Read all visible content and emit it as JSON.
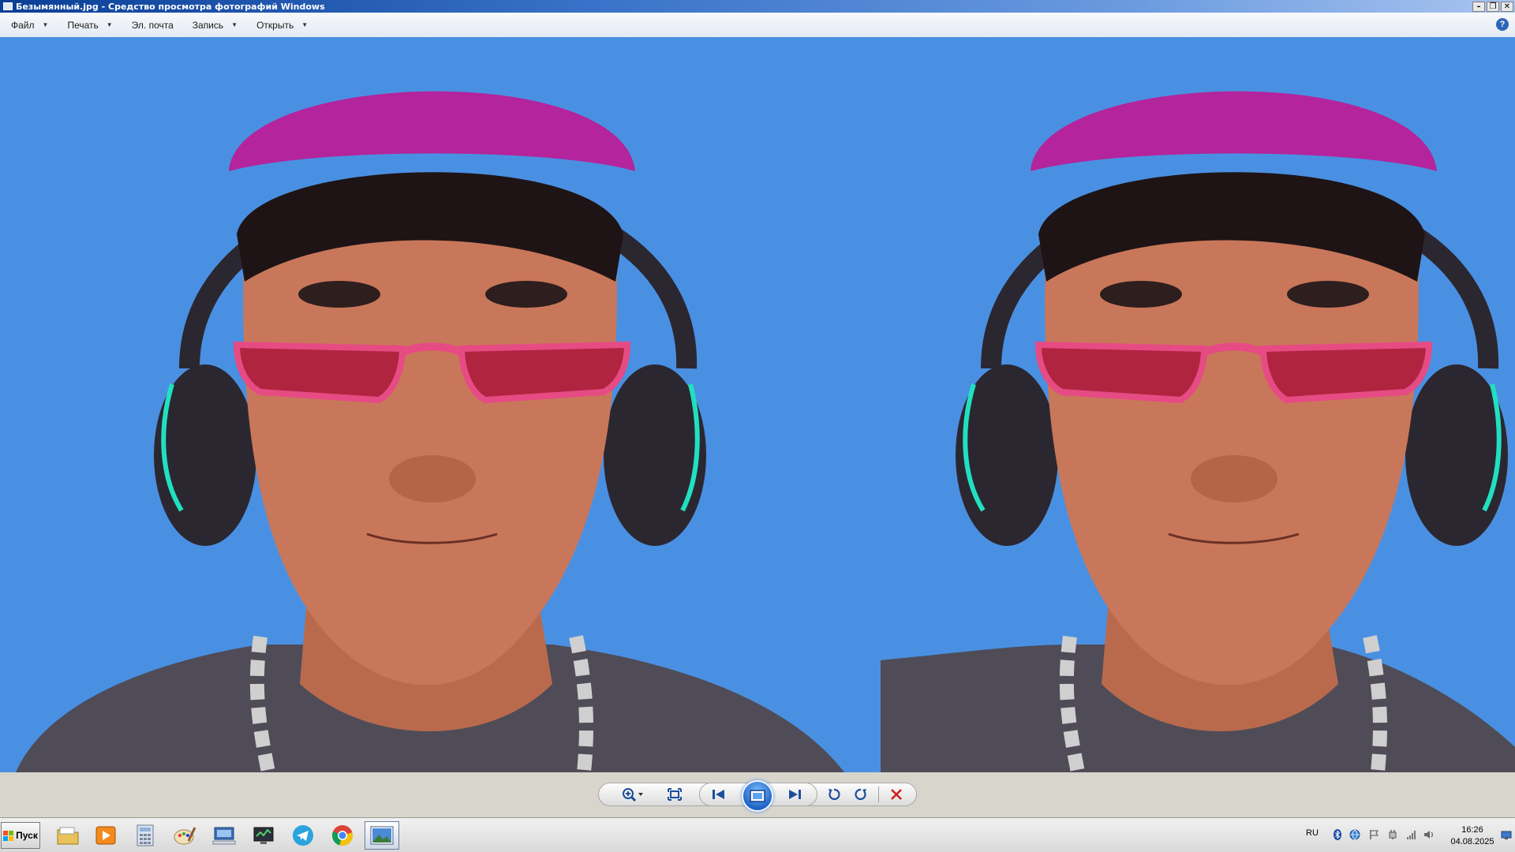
{
  "window": {
    "title": "Безымянный.jpg - Средство просмотра фотографий Windows",
    "minimize_label": "–",
    "restore_label": "❐",
    "close_label": "✕"
  },
  "menu": {
    "items": [
      {
        "label": "Файл",
        "has_dropdown": true
      },
      {
        "label": "Печать",
        "has_dropdown": true
      },
      {
        "label": "Эл. почта",
        "has_dropdown": false
      },
      {
        "label": "Запись",
        "has_dropdown": true
      },
      {
        "label": "Открыть",
        "has_dropdown": true
      }
    ],
    "help_label": "?"
  },
  "viewer": {
    "background_color": "#4a90e2",
    "image_content": "two 3D cartoon avatars side by side: man with magenta cap, pink sunglasses, headphones, silver chain, dark t-shirt"
  },
  "controls": {
    "buttons": [
      "zoom-icon",
      "fit-to-window-icon",
      "previous-icon",
      "slideshow-icon",
      "next-icon",
      "rotate-counterclockwise-icon",
      "rotate-clockwise-icon",
      "delete-icon"
    ]
  },
  "taskbar": {
    "start_label": "Пуск",
    "apps": [
      "file-explorer-icon",
      "media-player-icon",
      "calculator-icon",
      "paint-icon",
      "remote-desktop-icon",
      "network-monitor-icon",
      "telegram-icon",
      "chrome-icon",
      "photo-viewer-icon"
    ],
    "language": "RU",
    "time": "16:26",
    "date": "04.08.2025"
  }
}
